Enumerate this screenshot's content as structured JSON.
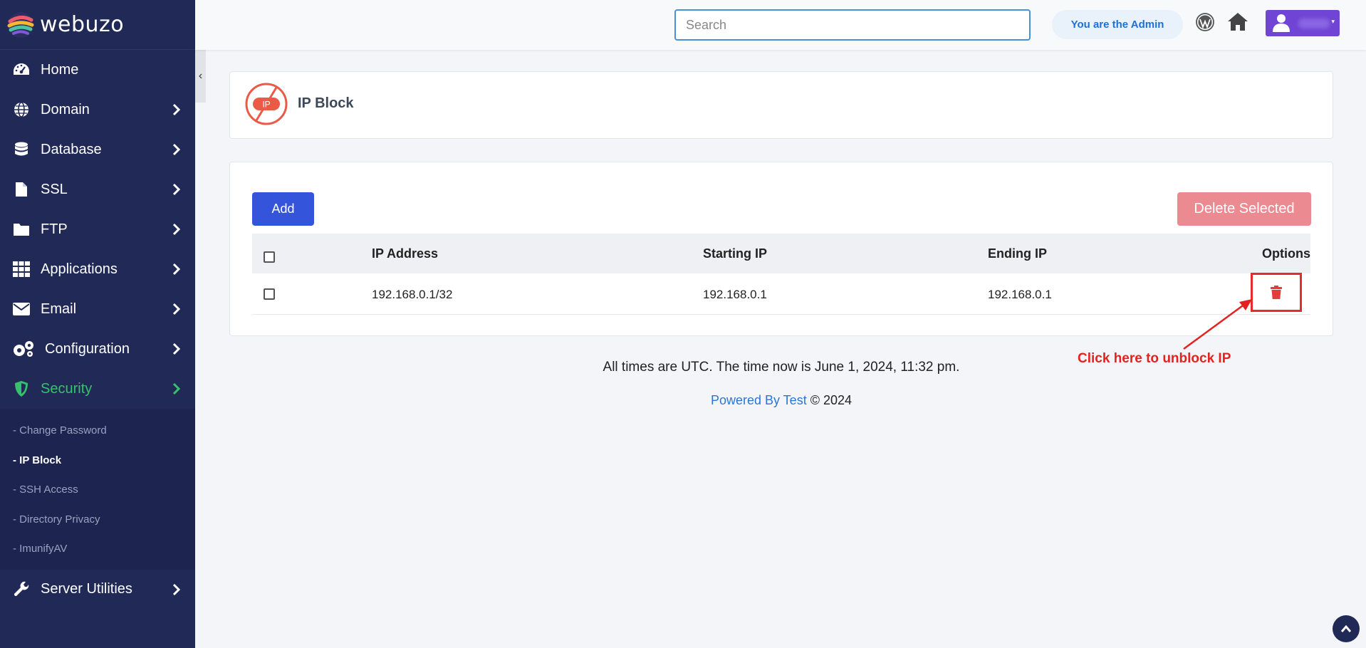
{
  "brand": {
    "name": "webuzo"
  },
  "sidebar": {
    "items": [
      {
        "label": "Home",
        "icon": "gauge-icon"
      },
      {
        "label": "Domain",
        "icon": "globe-icon"
      },
      {
        "label": "Database",
        "icon": "database-icon"
      },
      {
        "label": "SSL",
        "icon": "file-icon"
      },
      {
        "label": "FTP",
        "icon": "folder-icon"
      },
      {
        "label": "Applications",
        "icon": "grid-icon"
      },
      {
        "label": "Email",
        "icon": "envelope-icon"
      },
      {
        "label": "Configuration",
        "icon": "gears-icon"
      },
      {
        "label": "Security",
        "icon": "shield-icon"
      }
    ],
    "security_submenu": [
      {
        "label": "- Change Password"
      },
      {
        "label": "- IP Block"
      },
      {
        "label": "- SSH Access"
      },
      {
        "label": "- Directory Privacy"
      },
      {
        "label": "- ImunifyAV"
      }
    ],
    "last_item": {
      "label": "Server Utilities",
      "icon": "wrench-icon"
    },
    "collapse_glyph": "‹",
    "active_color": "#36c26b"
  },
  "header": {
    "search_placeholder": "Search",
    "admin_badge": "You are the Admin"
  },
  "page": {
    "title": "IP Block",
    "icon_text": "IP"
  },
  "table": {
    "add_label": "Add",
    "delete_selected_label": "Delete Selected",
    "columns": {
      "ip_address": "IP Address",
      "starting_ip": "Starting IP",
      "ending_ip": "Ending IP",
      "options": "Options"
    },
    "rows": [
      {
        "ip_address": "192.168.0.1/32",
        "starting_ip": "192.168.0.1",
        "ending_ip": "192.168.0.1"
      }
    ]
  },
  "annotation": {
    "text": "Click here to unblock IP",
    "color": "#e42222"
  },
  "footer": {
    "time_text": "All times are UTC. The time now is June 1, 2024, 11:32 pm.",
    "powered_link": "Powered By Test",
    "copyright": "© 2024"
  },
  "colors": {
    "sidebar_bg": "#212957",
    "primary": "#3455db",
    "danger_soft": "#ec8a92",
    "user_button": "#7044d4"
  }
}
